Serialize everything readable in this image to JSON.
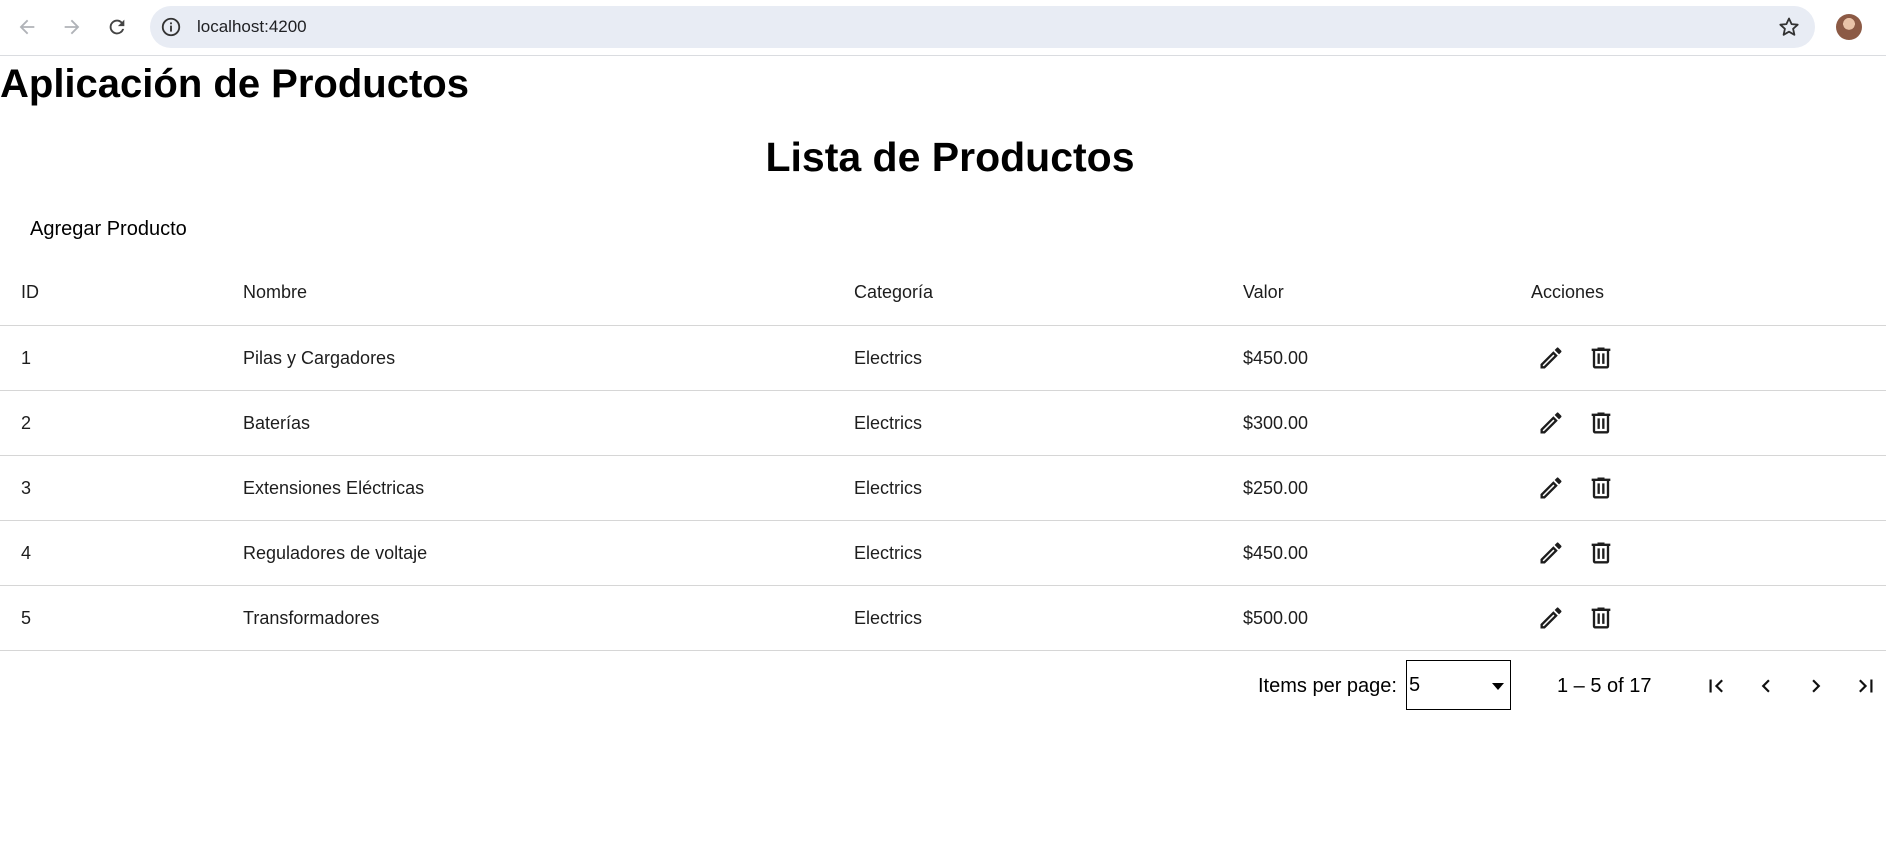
{
  "browser": {
    "url": "localhost:4200",
    "icons": {
      "back": "arrow-left-icon",
      "forward": "arrow-right-icon",
      "reload": "reload-icon",
      "site_info": "info-icon",
      "bookmark": "star-icon",
      "profile": "avatar"
    }
  },
  "app": {
    "title": "Aplicación de Productos"
  },
  "page": {
    "title": "Lista de Productos",
    "add_button_label": "Agregar Producto"
  },
  "table": {
    "headers": {
      "id": "ID",
      "name": "Nombre",
      "category": "Categoría",
      "value": "Valor",
      "actions": "Acciones"
    },
    "rows": [
      {
        "id": "1",
        "name": "Pilas y Cargadores",
        "category": "Electrics",
        "value": "$450.00"
      },
      {
        "id": "2",
        "name": "Baterías",
        "category": "Electrics",
        "value": "$300.00"
      },
      {
        "id": "3",
        "name": "Extensiones Eléctricas",
        "category": "Electrics",
        "value": "$250.00"
      },
      {
        "id": "4",
        "name": "Reguladores de voltaje",
        "category": "Electrics",
        "value": "$450.00"
      },
      {
        "id": "5",
        "name": "Transformadores",
        "category": "Electrics",
        "value": "$500.00"
      }
    ],
    "row_action_icons": [
      "pencil-icon",
      "trash-icon"
    ]
  },
  "paginator": {
    "items_per_page_label": "Items per page:",
    "items_per_page_value": "5",
    "range_label": "1 – 5 of 17",
    "icons": [
      "first-page-icon",
      "previous-page-icon",
      "next-page-icon",
      "last-page-icon"
    ]
  }
}
